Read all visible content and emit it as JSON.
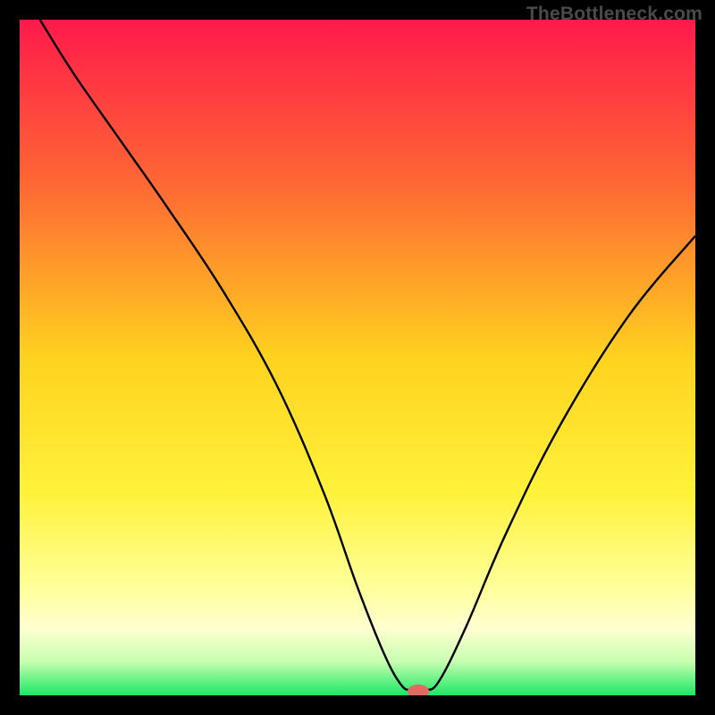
{
  "watermark": "TheBottleneck.com",
  "chart_data": {
    "type": "line",
    "title": "",
    "xlabel": "",
    "ylabel": "",
    "xlim": [
      0,
      100
    ],
    "ylim": [
      0,
      100
    ],
    "background_gradient": {
      "stops": [
        {
          "offset": 0,
          "color": "#ff1a4b"
        },
        {
          "offset": 25,
          "color": "#ff6a33"
        },
        {
          "offset": 50,
          "color": "#ffd21f"
        },
        {
          "offset": 70,
          "color": "#fff23a"
        },
        {
          "offset": 84,
          "color": "#ffff9a"
        },
        {
          "offset": 90,
          "color": "#ffffd0"
        },
        {
          "offset": 95,
          "color": "#c8ffb0"
        },
        {
          "offset": 100,
          "color": "#1ae864"
        }
      ]
    },
    "series": [
      {
        "name": "bottleneck-curve",
        "color": "#000000",
        "x": [
          3,
          8,
          15,
          22,
          30,
          38,
          45,
          50,
          54,
          56.5,
          58,
          60,
          62,
          66,
          72,
          80,
          90,
          100
        ],
        "y": [
          100,
          92,
          82,
          72,
          60,
          46,
          30,
          16,
          6,
          1.5,
          0.8,
          0.8,
          2,
          10,
          24,
          40,
          56,
          68
        ]
      }
    ],
    "marker": {
      "x": 59,
      "y": 0.6,
      "rx": 1.6,
      "ry": 1.0,
      "fill": "#e16a63"
    }
  }
}
